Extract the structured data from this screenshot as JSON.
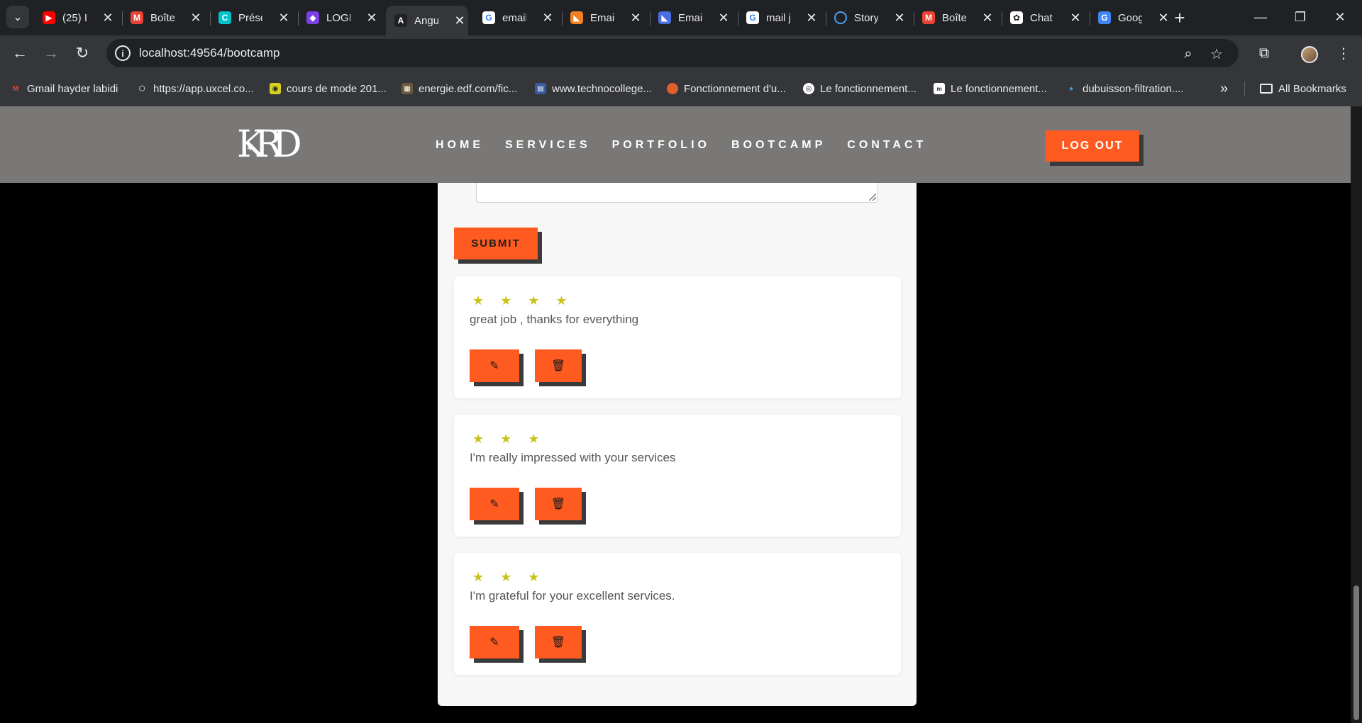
{
  "browser": {
    "tabs": [
      {
        "title": "(25) I",
        "icon": "youtube-icon",
        "color": "#ff0000",
        "glyph": "▶"
      },
      {
        "title": "Boîte",
        "icon": "gmail-icon",
        "color": "#ea4335",
        "glyph": "M"
      },
      {
        "title": "Prése",
        "icon": "canva-icon",
        "color": "#00c4cc",
        "glyph": "C"
      },
      {
        "title": "LOGI",
        "icon": "app-icon",
        "color": "#7b3fe4",
        "glyph": "◆"
      },
      {
        "title": "Angu",
        "icon": "angular-icon",
        "color": "#202124",
        "glyph": "A",
        "active": true
      },
      {
        "title": "email",
        "icon": "google-icon",
        "color": "#ffffff",
        "glyph": "G"
      },
      {
        "title": "Emai",
        "icon": "stack-icon",
        "color": "#f48024",
        "glyph": "◣"
      },
      {
        "title": "Emai",
        "icon": "bootstrap-icon",
        "color": "#4a6ee0",
        "glyph": "◣"
      },
      {
        "title": "mail j",
        "icon": "google-icon",
        "color": "#ffffff",
        "glyph": "G"
      },
      {
        "title": "Story",
        "icon": "loading-icon",
        "color": "#202124",
        "glyph": "◌"
      },
      {
        "title": "Boîte",
        "icon": "gmail-icon",
        "color": "#ea4335",
        "glyph": "M"
      },
      {
        "title": "Chat",
        "icon": "chatgpt-icon",
        "color": "#ffffff",
        "glyph": "✿"
      },
      {
        "title": "Goog",
        "icon": "google-translate-icon",
        "color": "#4285f4",
        "glyph": "G"
      }
    ],
    "url": "localhost:49564/bootcamp",
    "bookmarks": [
      {
        "label": "Gmail hayder labidi",
        "icon": "gmail-icon",
        "color": "#ea4335",
        "glyph": "M"
      },
      {
        "label": "https://app.uxcel.co...",
        "icon": "cube-icon",
        "color": "#35363a",
        "glyph": "⬡"
      },
      {
        "label": "cours de mode 201...",
        "icon": "coin-icon",
        "color": "#d8d020",
        "glyph": "◉"
      },
      {
        "label": "energie.edf.com/fic...",
        "icon": "image-icon",
        "color": "#6b5a3a",
        "glyph": "▦"
      },
      {
        "label": "www.technocollege...",
        "icon": "site-icon",
        "color": "#3a5aa0",
        "glyph": "▤"
      },
      {
        "label": "Fonctionnement d'u...",
        "icon": "site-icon",
        "color": "#e0602a",
        "glyph": "●"
      },
      {
        "label": "Le fonctionnement...",
        "icon": "radio-icon",
        "color": "#35363a",
        "glyph": "◎"
      },
      {
        "label": "Le fonctionnement...",
        "icon": "msg-icon",
        "color": "#ffffff",
        "glyph": "m"
      },
      {
        "label": "dubuisson-filtration....",
        "icon": "drop-icon",
        "color": "#3aa0d8",
        "glyph": "💧"
      }
    ],
    "all_bookmarks": "All Bookmarks"
  },
  "site": {
    "logo": "KRD",
    "nav": [
      "HOME",
      "SERVICES",
      "PORTFOLIO",
      "BOOTCAMP",
      "CONTACT"
    ],
    "logout": "LOG OUT",
    "accent": "#ff5a1f"
  },
  "form": {
    "submit": "SUBMIT"
  },
  "reviews": [
    {
      "stars": "★ ★ ★ ★",
      "rating": 4,
      "comment": "great job , thanks for everything"
    },
    {
      "stars": "★ ★ ★",
      "rating": 3,
      "comment": "I'm really impressed with your services"
    },
    {
      "stars": "★ ★ ★",
      "rating": 3,
      "comment": "I'm grateful for your excellent services."
    }
  ]
}
